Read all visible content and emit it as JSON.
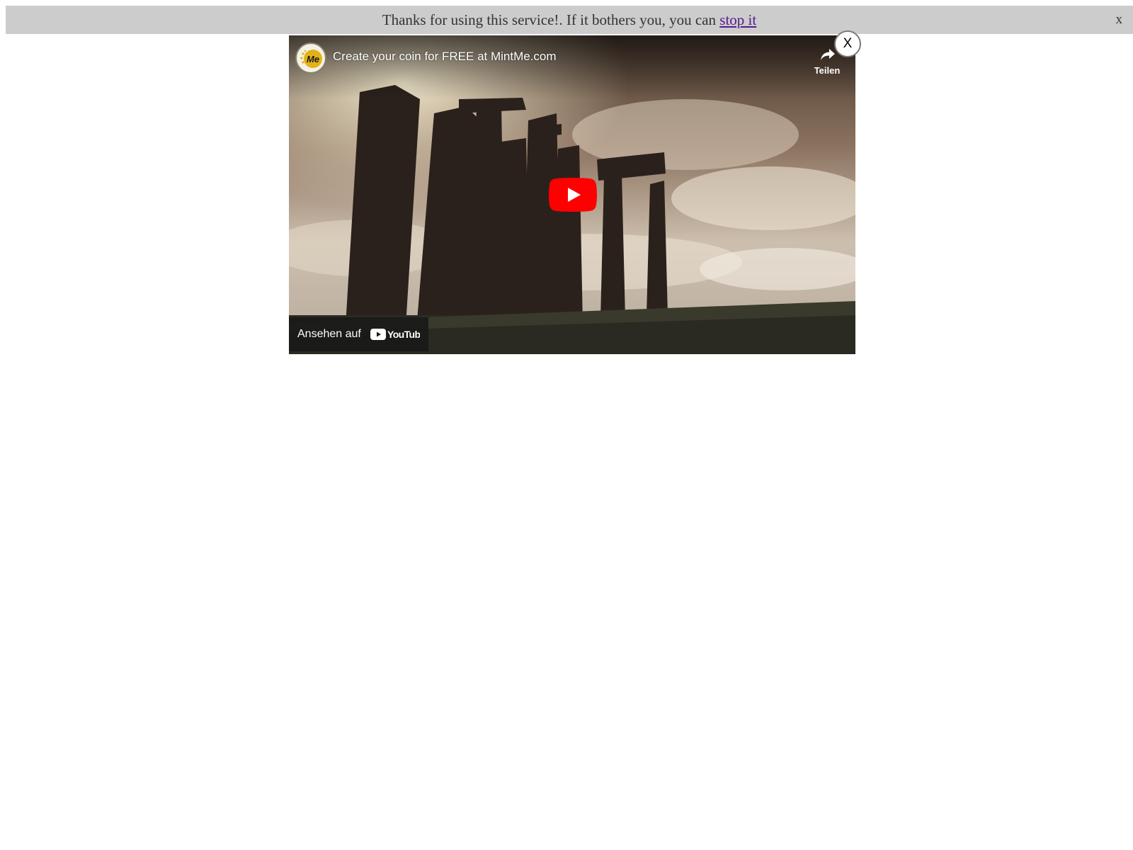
{
  "notice": {
    "message": "Thanks for using this service!. If it bothers you, you can",
    "link_label": "stop it",
    "close_label": "x",
    "background_color": "#cccccc",
    "link_color": "#551a8b"
  },
  "video": {
    "channel_avatar_text": "Me",
    "title": "Create your coin for FREE at MintMe.com",
    "share_label": "Teilen",
    "share_icon": "share-arrow-icon",
    "play_icon": "play-icon",
    "play_button_color": "#ff0000",
    "watch_on_label": "Ansehen auf",
    "platform_logo_text": "YouTube"
  },
  "overlay": {
    "close_label": "X"
  }
}
